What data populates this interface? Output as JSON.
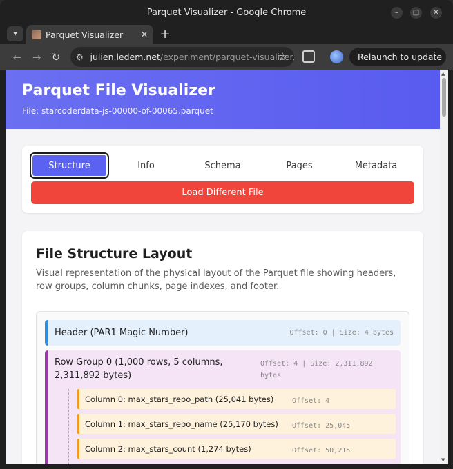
{
  "window": {
    "title": "Parquet Visualizer - Google Chrome"
  },
  "browser": {
    "tab_title": "Parquet Visualizer",
    "url_host": "julien.ledem.net",
    "url_path": "/experiment/parquet-visualizer.html",
    "relaunch_label": "Relaunch to update"
  },
  "page": {
    "title": "Parquet File Visualizer",
    "file_label": "File: starcoderdata-js-00000-of-00065.parquet",
    "tabs": [
      {
        "label": "Structure",
        "active": true
      },
      {
        "label": "Info",
        "active": false
      },
      {
        "label": "Schema",
        "active": false
      },
      {
        "label": "Pages",
        "active": false
      },
      {
        "label": "Metadata",
        "active": false
      }
    ],
    "load_button": "Load Different File",
    "section_title": "File Structure Layout",
    "section_desc": "Visual representation of the physical layout of the Parquet file showing headers, row groups, column chunks, page indexes, and footer.",
    "header_block": {
      "label": "Header (PAR1 Magic Number)",
      "meta": "Offset: 0 | Size: 4 bytes"
    },
    "row_group": {
      "label": "Row Group 0 (1,000 rows, 5 columns, 2,311,892 bytes)",
      "meta": "Offset: 4 | Size: 2,311,892 bytes"
    },
    "columns": [
      {
        "label": "Column 0: max_stars_repo_path (25,041 bytes)",
        "meta": "Offset: 4"
      },
      {
        "label": "Column 1: max_stars_repo_name (25,170 bytes)",
        "meta": "Offset: 25,045"
      },
      {
        "label": "Column 2: max_stars_count (1,274 bytes)",
        "meta": "Offset: 50,215"
      }
    ]
  }
}
